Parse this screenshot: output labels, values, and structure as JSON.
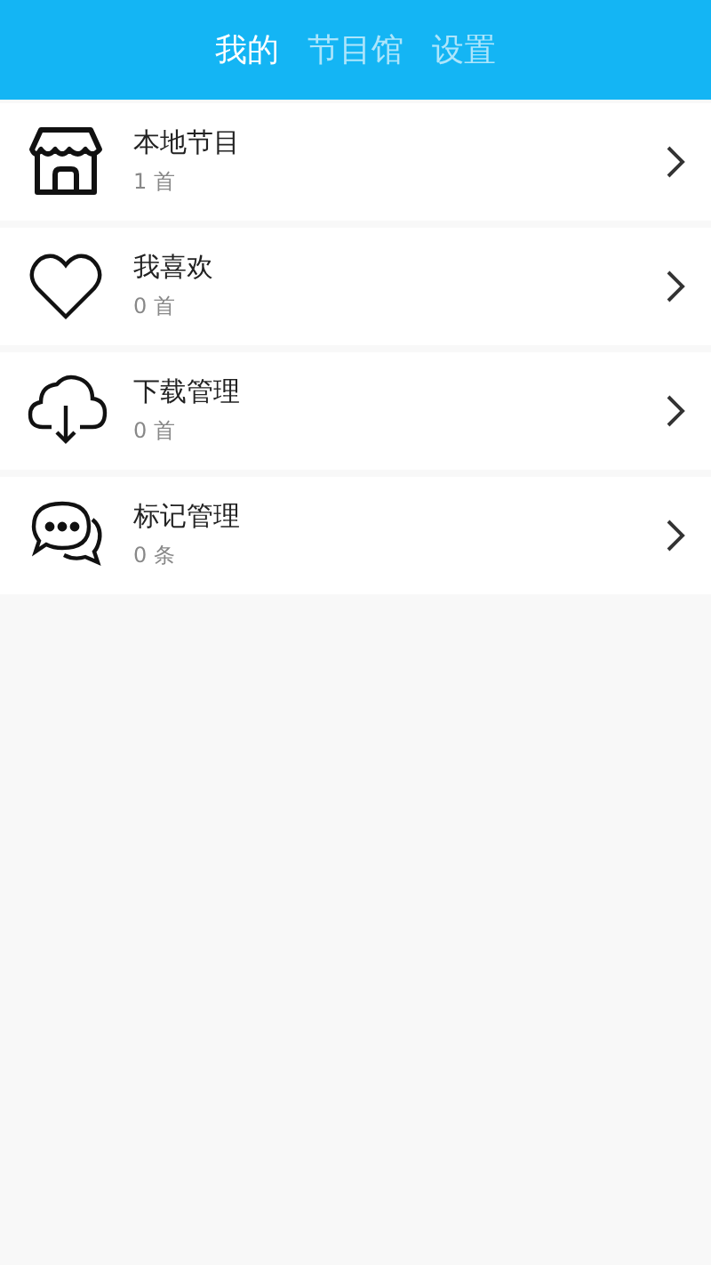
{
  "tabs": [
    {
      "label": "我的",
      "selected": true
    },
    {
      "label": "节目馆",
      "selected": false
    },
    {
      "label": "设置",
      "selected": false
    }
  ],
  "items": [
    {
      "kind": "store",
      "title": "本地节目",
      "count": "1 首"
    },
    {
      "kind": "heart",
      "title": "我喜欢",
      "count": "0 首"
    },
    {
      "kind": "download",
      "title": "下载管理",
      "count": "0 首"
    },
    {
      "kind": "chat",
      "title": "标记管理",
      "count": "0 条"
    }
  ]
}
